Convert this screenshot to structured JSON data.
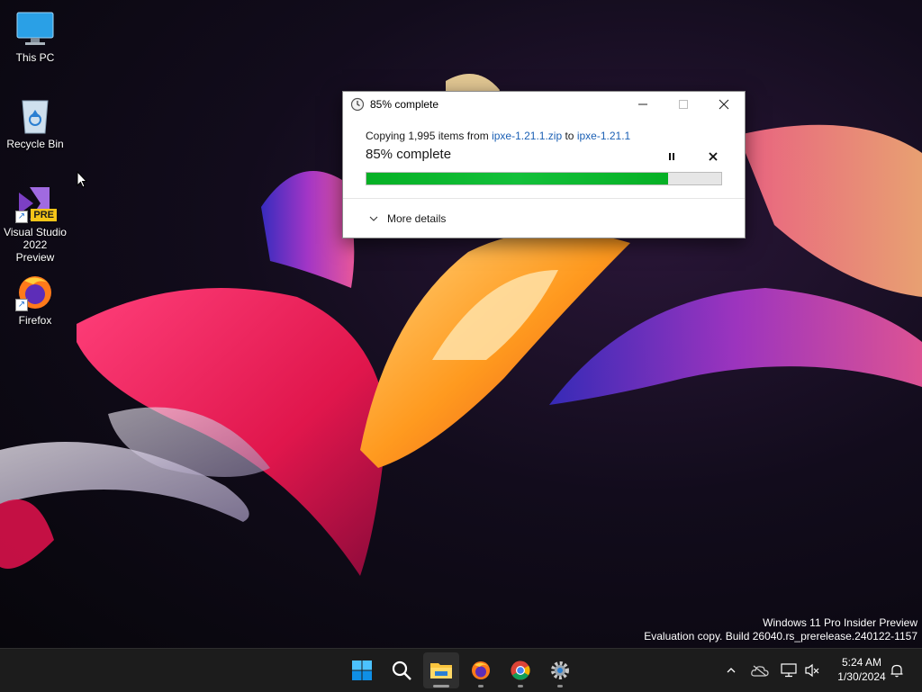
{
  "desktop": {
    "icons": [
      {
        "label": "This PC"
      },
      {
        "label": "Recycle Bin"
      },
      {
        "label": "Visual Studio 2022 Preview",
        "badge": "PRE"
      },
      {
        "label": "Firefox"
      }
    ]
  },
  "dialog": {
    "title": "85% complete",
    "copy_prefix": "Copying 1,995 items from",
    "source": "ipxe-1.21.1.zip",
    "to_word": "to",
    "destination": "ipxe-1.21.1",
    "percent_text": "85% complete",
    "progress_fraction": 0.85,
    "more_details": "More details"
  },
  "watermark": {
    "line1": "Windows 11 Pro Insider Preview",
    "line2": "Evaluation copy. Build 26040.rs_prerelease.240122-1157"
  },
  "taskbar": {
    "apps": [
      "start-icon",
      "search-icon",
      "file-explorer-icon",
      "firefox-icon",
      "chrome-icon",
      "settings-icon"
    ],
    "tray": [
      "chevron-up-icon",
      "onedrive-icon",
      "network-icon",
      "volume-muted-icon",
      "notification-bell-icon"
    ],
    "time": "5:24 AM",
    "date": "1/30/2024"
  },
  "colors": {
    "progress_green": "#06b025",
    "link_blue": "#1a5fb4",
    "taskbar_bg": "#1c1c1c"
  }
}
